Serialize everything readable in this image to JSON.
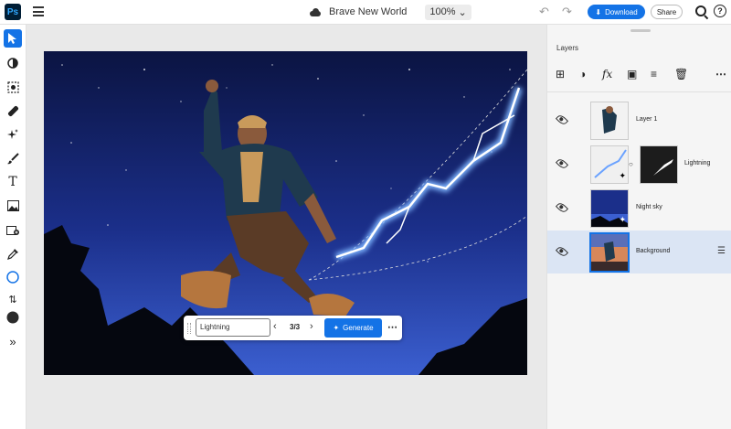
{
  "app": {
    "logo_text": "Ps",
    "document_title": "Brave New World",
    "zoom": "100%"
  },
  "header": {
    "download_label": "Download",
    "share_label": "Share"
  },
  "toolbar": {
    "tools": [
      {
        "name": "move-tool",
        "icon": "pointer"
      },
      {
        "name": "adjustment-tool",
        "icon": "half-circle"
      },
      {
        "name": "select-subject-tool",
        "icon": "select"
      },
      {
        "name": "heal-tool",
        "icon": "bandage"
      },
      {
        "name": "generative-fill-tool",
        "icon": "sparkle"
      },
      {
        "name": "brush-tool",
        "icon": "brush"
      },
      {
        "name": "type-tool",
        "icon": "T"
      },
      {
        "name": "place-image-tool",
        "icon": "image"
      },
      {
        "name": "add-image-tool",
        "icon": "image-add"
      },
      {
        "name": "eyedropper-tool",
        "icon": "eyedropper"
      },
      {
        "name": "shape-tool",
        "icon": "circle"
      },
      {
        "name": "swap-colors",
        "icon": "swap"
      },
      {
        "name": "color-swatch",
        "icon": "swatch"
      },
      {
        "name": "expand-toolbar",
        "icon": "chevron-double-right"
      }
    ]
  },
  "generate_bar": {
    "prompt_value": "Lightning",
    "counter": "3/3",
    "generate_label": "Generate"
  },
  "layers_panel": {
    "title": "Layers",
    "layers": [
      {
        "name": "Layer 1"
      },
      {
        "name": "Lightning"
      },
      {
        "name": "Night sky"
      },
      {
        "name": "Background"
      }
    ]
  },
  "colors": {
    "accent": "#1473e6",
    "selected_row": "#dbe5f4"
  }
}
